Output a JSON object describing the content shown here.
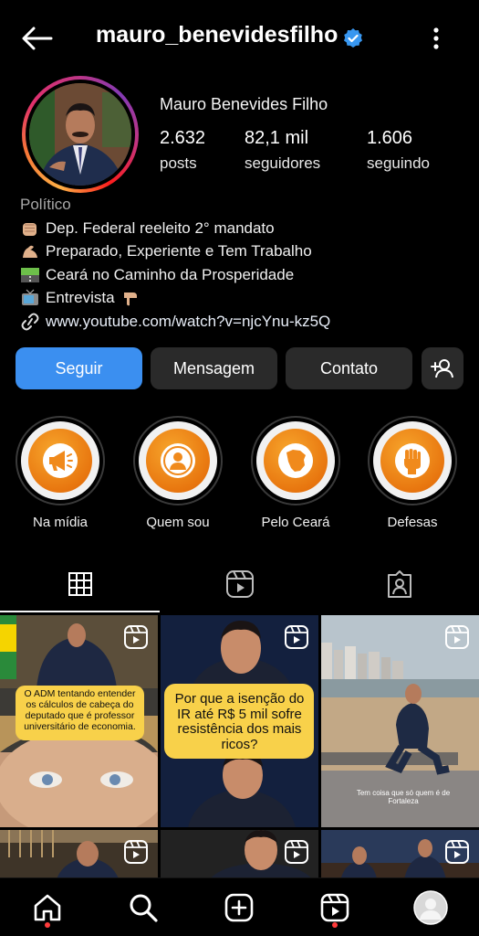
{
  "header": {
    "username": "mauro_benevidesfilho",
    "icons": [
      "back-arrow-icon",
      "verified-badge-icon",
      "more-vertical-icon"
    ]
  },
  "profile": {
    "display_name": "Mauro Benevides Filho",
    "stats": [
      {
        "value": "2.632",
        "label": "posts"
      },
      {
        "value": "82,1 mil",
        "label": "seguidores"
      },
      {
        "value": "1.606",
        "label": "seguindo"
      }
    ]
  },
  "bio": {
    "category": "Político",
    "lines": [
      {
        "icon": "fist-emoji-icon",
        "text": "Dep. Federal reeleito 2° mandato"
      },
      {
        "icon": "flexed-bicep-emoji-icon",
        "text": "Preparado, Experiente e Tem Trabalho"
      },
      {
        "icon": "road-emoji-icon",
        "text": "Ceará no Caminho da Prosperidade"
      },
      {
        "icon": "tv-emoji-icon",
        "text": "Entrevista"
      },
      {
        "icon": "link-icon",
        "text": "www.youtube.com/watch?v=njcYnu-kz5Q"
      }
    ],
    "pointing_down_icon": "pointing-down-emoji-icon"
  },
  "actions": {
    "follow": "Seguir",
    "message": "Mensagem",
    "contact": "Contato",
    "add_user_icon": "add-user-icon"
  },
  "highlights": [
    {
      "label": "Na mídia",
      "icon": "megaphone-icon"
    },
    {
      "label": "Quem sou",
      "icon": "person-icon"
    },
    {
      "label": "Pelo Ceará",
      "icon": "ceara-map-icon"
    },
    {
      "label": "Defesas",
      "icon": "raised-fist-icon"
    }
  ],
  "tabs": [
    {
      "name": "grid",
      "icon": "grid-icon",
      "active": true
    },
    {
      "name": "reels",
      "icon": "reels-icon",
      "active": false
    },
    {
      "name": "tagged",
      "icon": "tagged-person-icon",
      "active": false
    }
  ],
  "posts": [
    {
      "caption": "O ADM tentando entender os cálculos de cabeça do deputado que é professor universitário de economia."
    },
    {
      "caption": "Por que a isenção do IR até R$ 5 mil sofre resistência dos mais ricos?"
    },
    {
      "caption": "Tem coisa que só quem é de Fortaleza"
    }
  ],
  "bottom_nav": [
    "home-icon",
    "search-icon",
    "create-icon",
    "reels-icon",
    "profile-avatar-icon"
  ],
  "colors": {
    "accent": "#3b8ff0",
    "highlight_orange": "#f08a1c",
    "verified": "#3897f0"
  }
}
